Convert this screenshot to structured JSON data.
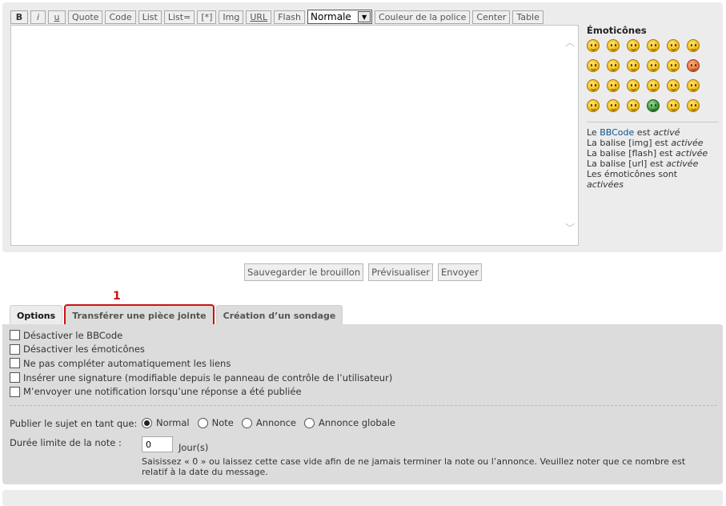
{
  "toolbar": {
    "buttons": [
      "B",
      "i",
      "u",
      "Quote",
      "Code",
      "List",
      "List=",
      "[*]",
      "Img",
      "URL",
      "Flash"
    ],
    "font_size_value": "Normale",
    "buttons_after": [
      "Couleur de la police",
      "Center",
      "Table"
    ]
  },
  "smilies": {
    "title": "Émoticônes",
    "icons": [
      "laughing-smiley-icon",
      "grin-smiley-icon",
      "wink-smiley-icon",
      "eek-smiley-icon",
      "surprised-smiley-icon",
      "shocked-smiley-icon",
      "confused-smiley-icon",
      "cool-smiley-icon",
      "tongue-smiley-icon",
      "neutral-smiley-icon",
      "mrgreen-smiley-icon",
      "razz-smiley-icon",
      "rolleyes-smiley-icon",
      "evil-smiley-icon",
      "twisted-smiley-icon",
      "sad-smiley-icon",
      "exclaim-smiley-icon",
      "question-smiley-icon",
      "idea-smiley-icon",
      "arrow-smiley-icon",
      "mad-smiley-icon",
      "green-smiley-icon",
      "geek-smiley-icon",
      "ugeek-smiley-icon"
    ]
  },
  "bbcode_info": {
    "l1_pre": "Le ",
    "l1_link": "BBCode",
    "l1_mid": " est ",
    "l1_state": "activé",
    "l2_pre": "La balise [img] est ",
    "l2_state": "activée",
    "l3_pre": "La balise [flash] est ",
    "l3_state": "activée",
    "l4_pre": "La balise [url] est ",
    "l4_state": "activée",
    "l5_pre": "Les émoticônes sont",
    "l5_state": "activées"
  },
  "submit": {
    "save_draft": "Sauvegarder le brouillon",
    "preview": "Prévisualiser",
    "send": "Envoyer"
  },
  "annotation": {
    "number": "1"
  },
  "tabs": [
    {
      "label": "Options"
    },
    {
      "label": "Transférer une pièce jointe"
    },
    {
      "label": "Création d’un sondage"
    }
  ],
  "options": {
    "checkboxes": [
      "Désactiver le BBCode",
      "Désactiver les émoticônes",
      "Ne pas compléter automatiquement les liens",
      "Insérer une signature (modifiable depuis le panneau de contrôle de l’utilisateur)",
      "M’envoyer une notification lorsqu’une réponse a été publiée"
    ],
    "topic_type_label": "Publier le sujet en tant que:",
    "topic_types": [
      "Normal",
      "Note",
      "Annonce",
      "Annonce globale"
    ],
    "selected_type": "Normal",
    "duration_label": "Durée limite de la note :",
    "duration_value": "0",
    "duration_unit": "Jour(s)",
    "help_text": "Saisissez « 0 » ou laissez cette case vide afin de ne jamais terminer la note ou l’annonce. Veuillez noter que ce nombre est relatif à la date du message."
  }
}
